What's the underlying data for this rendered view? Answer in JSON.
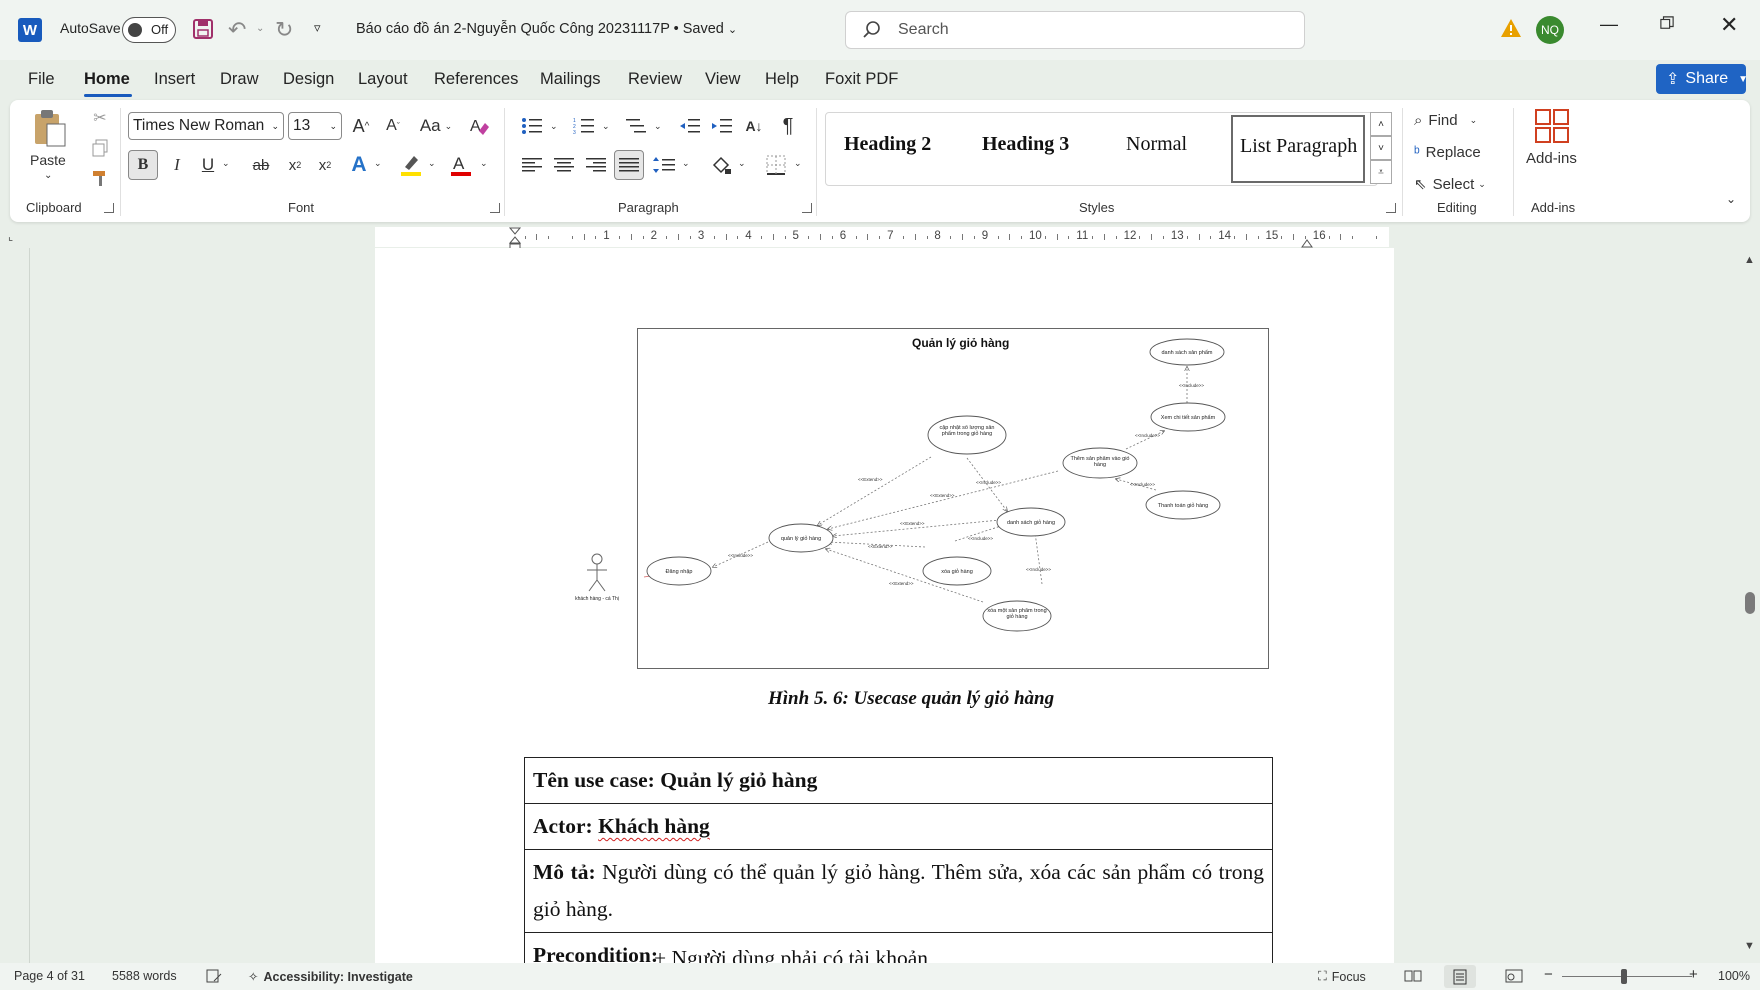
{
  "app": {
    "autosave_label": "AutoSave",
    "autosave_state": "Off",
    "doc_title": "Báo cáo đồ án 2-Nguyễn Quốc Công 20231117P • Saved",
    "search_placeholder": "Search",
    "user_initials": "NQ",
    "word_logo": "W"
  },
  "menu": {
    "tabs": [
      "File",
      "Home",
      "Insert",
      "Draw",
      "Design",
      "Layout",
      "References",
      "Mailings",
      "Review",
      "View",
      "Help",
      "Foxit PDF"
    ],
    "active": "Home",
    "share_label": "Share"
  },
  "ribbon": {
    "clipboard": {
      "paste_label": "Paste",
      "group_label": "Clipboard"
    },
    "font": {
      "font_name": "Times New Roman",
      "font_size": "13",
      "group_label": "Font",
      "change_case_label": "Aa"
    },
    "paragraph": {
      "group_label": "Paragraph"
    },
    "styles": {
      "items": [
        "Heading 2",
        "Heading 3",
        "Normal",
        "List Paragraph"
      ],
      "group_label": "Styles"
    },
    "editing": {
      "find_label": "Find",
      "replace_label": "Replace",
      "select_label": "Select",
      "group_label": "Editing"
    },
    "addins": {
      "label": "Add-ins",
      "group_label": "Add-ins"
    }
  },
  "ruler": {
    "numbers": [
      "1",
      "2",
      "3",
      "4",
      "5",
      "6",
      "7",
      "8",
      "9",
      "10",
      "11",
      "12",
      "13",
      "14",
      "15",
      "16"
    ]
  },
  "document": {
    "diagram": {
      "title": "Quản lý giỏ hàng",
      "actor": "khách hàng - cá Thị",
      "usecases": [
        "danh sách sản phẩm",
        "Xem chi tiết sản phẩm",
        "cập nhật số lượng sản phẩm trong giỏ hàng",
        "Thêm sản phẩm vào giỏ hàng",
        "Thanh toán giỏ hàng",
        "danh sách giỏ hàng",
        "quản lý giỏ hàng",
        "Đăng nhập",
        "xóa giỏ hàng",
        "xóa một sản phẩm trong giỏ hàng"
      ],
      "include_label": "<<Include>>",
      "extend_label": "<<Extend>>"
    },
    "caption": "Hình 5. 6: Usecase quản lý giỏ hàng",
    "table": {
      "row1_label": "Tên use case:",
      "row1_value": "Quản lý giỏ hàng",
      "row2_label": "Actor:",
      "row2_value": "Khách hàng",
      "row3_label": "Mô tả:",
      "row3_value": "Người dùng có thể quản lý giỏ hàng. Thêm sửa, xóa các sản phẩm có trong giỏ hàng.",
      "row4_label": "Precondition:",
      "row4_item": "+ Người dùng phải có tài khoản"
    }
  },
  "status": {
    "page": "Page 4 of 31",
    "words": "5588 words",
    "accessibility": "Accessibility: Investigate",
    "focus": "Focus",
    "zoom": "100%"
  }
}
